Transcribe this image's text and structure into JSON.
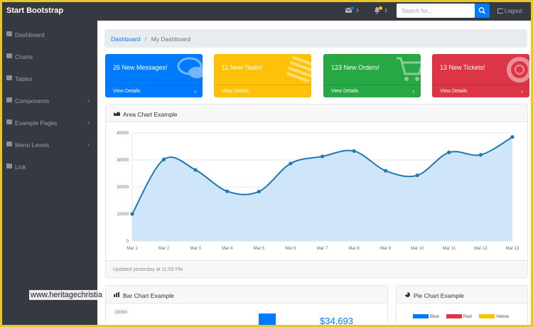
{
  "navbar": {
    "brand": "Start Bootstrap",
    "search_placeholder": "Search for...",
    "logout_label": "Logout",
    "message_icon": "envelope-icon",
    "alert_icon": "bell-icon"
  },
  "sidebar": {
    "items": [
      {
        "label": "Dashboard",
        "icon": "dashboard-icon",
        "has_children": false
      },
      {
        "label": "Charts",
        "icon": "area-chart-icon",
        "has_children": false
      },
      {
        "label": "Tables",
        "icon": "table-icon",
        "has_children": false
      },
      {
        "label": "Components",
        "icon": "wrench-icon",
        "has_children": true
      },
      {
        "label": "Example Pages",
        "icon": "file-icon",
        "has_children": true
      },
      {
        "label": "Menu Levels",
        "icon": "sitemap-icon",
        "has_children": true
      },
      {
        "label": "Link",
        "icon": "link-icon",
        "has_children": false
      }
    ]
  },
  "breadcrumb": {
    "home": "Dashboard",
    "separator": "/",
    "current": "My Dashboard"
  },
  "cards": [
    {
      "title": "26 New Messages!",
      "footer": "View Details",
      "color": "#007bff",
      "icon": "comments-icon"
    },
    {
      "title": "11 New Tasks!",
      "footer": "View Details",
      "color": "#ffc107",
      "icon": "list-icon"
    },
    {
      "title": "123 New Orders!",
      "footer": "View Details",
      "color": "#28a745",
      "icon": "shopping-cart-icon"
    },
    {
      "title": "13 New Tickets!",
      "footer": "View Details",
      "color": "#dc3545",
      "icon": "life-ring-icon"
    }
  ],
  "area_panel": {
    "title": "Area Chart Example",
    "footer": "Updated yesterday at 11:59 PM"
  },
  "bar_panel": {
    "title": "Bar Chart Example",
    "ytick_top": "15000",
    "value": "$34,693"
  },
  "pie_panel": {
    "title": "Pie Chart Example",
    "legend": [
      {
        "label": "Blue",
        "color": "#007bff"
      },
      {
        "label": "Red",
        "color": "#dc3545"
      },
      {
        "label": "Yellow",
        "color": "#ffc107"
      }
    ]
  },
  "watermark": "www.heritagechristia",
  "chart_data": {
    "type": "area",
    "categories": [
      "Mar 1",
      "Mar 2",
      "Mar 3",
      "Mar 4",
      "Mar 5",
      "Mar 6",
      "Mar 7",
      "Mar 8",
      "Mar 9",
      "Mar 10",
      "Mar 11",
      "Mar 12",
      "Mar 13"
    ],
    "values": [
      10000,
      30200,
      26300,
      18400,
      18300,
      28700,
      31300,
      33300,
      26000,
      24300,
      32800,
      31900,
      38500
    ],
    "yticks": [
      "0",
      "10000",
      "20000",
      "30000",
      "40000"
    ],
    "ylim": [
      0,
      40000
    ],
    "grid": true,
    "line_color": "#1f78b4",
    "fill_color": "#cfe6fa"
  }
}
